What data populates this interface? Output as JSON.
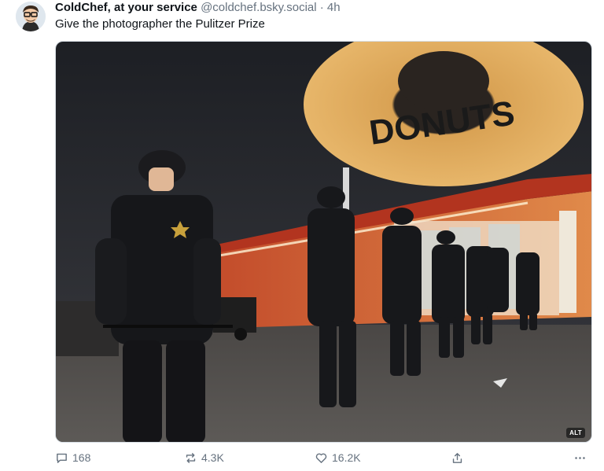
{
  "post": {
    "author": {
      "display_name": "ColdChef, at your service",
      "handle": "@coldchef.bsky.social",
      "separator": "·",
      "timestamp": "4h"
    },
    "text": "Give the photographer the Pulitzer Prize",
    "media": {
      "sign_text": "DONUTS",
      "alt_badge": "ALT"
    },
    "actions": {
      "reply_count": "168",
      "repost_count": "4.3K",
      "like_count": "16.2K"
    },
    "icons": {
      "reply": "reply-bubble-icon",
      "repost": "repost-arrows-icon",
      "like": "heart-icon",
      "share": "share-upload-icon",
      "more": "more-dots-icon"
    }
  }
}
